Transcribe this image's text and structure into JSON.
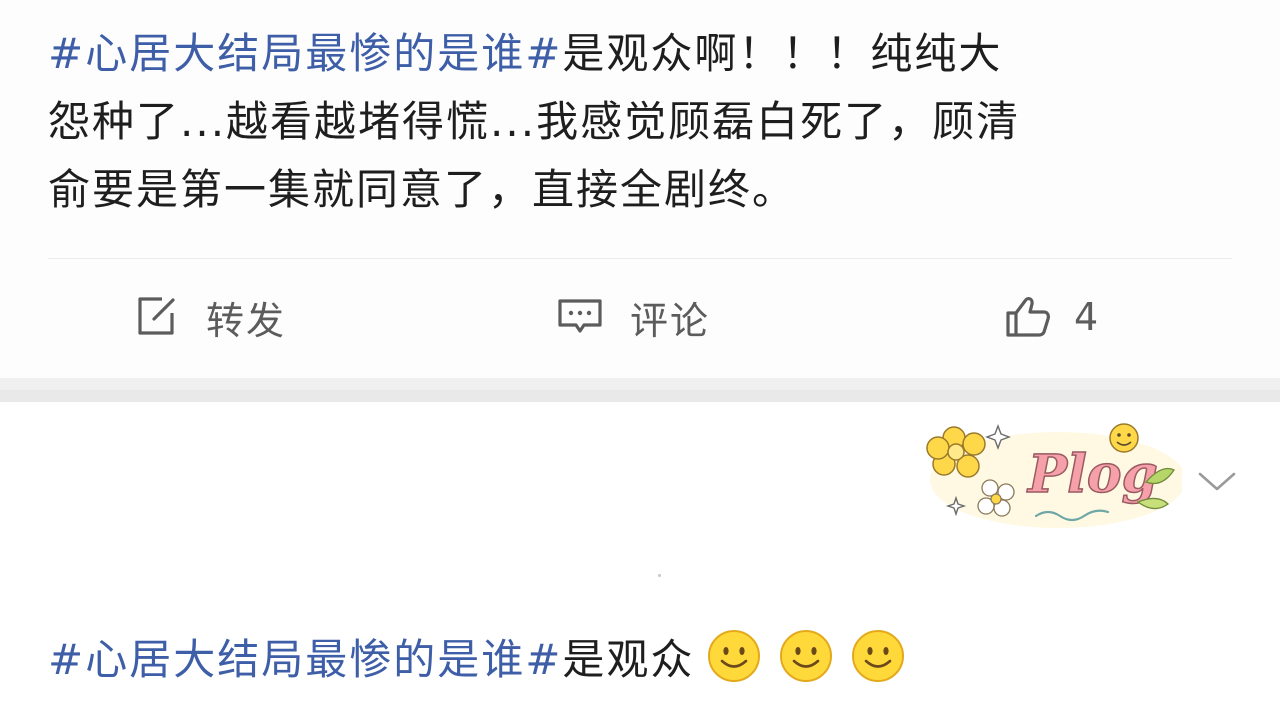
{
  "post1": {
    "hashtag": "#心居大结局最惨的是谁#",
    "text_line1": "是观众啊！！！纯纯大",
    "text_line2": "怨种了...越看越堵得慌...我感觉顾磊白死了，顾清",
    "text_line3": "俞要是第一集就同意了，直接全剧终。",
    "actions": {
      "repost_label": "转发",
      "comment_label": "评论",
      "like_count": "4"
    }
  },
  "post2": {
    "sticker_text": "Plog",
    "hashtag": "#心居大结局最惨的是谁#",
    "text": "是观众",
    "emoji_count": 3
  },
  "icons": {
    "repost": "share-edit-icon",
    "comment": "comment-bubble-icon",
    "like": "thumbs-up-icon",
    "expand": "chevron-down-icon",
    "emoji": "smiley-emoji-icon"
  },
  "colors": {
    "hashtag": "#3e5ea8",
    "text": "#1e1e1e",
    "action_gray": "#5c5c5c",
    "separator": "#f0f0f0"
  }
}
